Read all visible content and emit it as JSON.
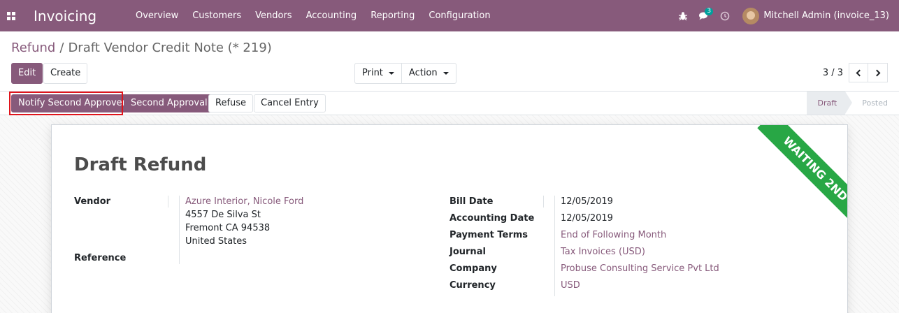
{
  "navbar": {
    "brand": "Invoicing",
    "menu": [
      "Overview",
      "Customers",
      "Vendors",
      "Accounting",
      "Reporting",
      "Configuration"
    ],
    "messages_count": "3",
    "user_name": "Mitchell Admin (invoice_13)",
    "icons": [
      "apps-grid-icon",
      "bug-icon",
      "chat-bubbles-icon",
      "clock-icon"
    ]
  },
  "breadcrumb": {
    "parent": "Refund",
    "separator": "/",
    "current": "Draft Vendor Credit Note (* 219)"
  },
  "toolbar": {
    "edit_label": "Edit",
    "create_label": "Create",
    "print_label": "Print",
    "action_label": "Action",
    "pager_value": "3 / 3"
  },
  "statusbar": {
    "notify_label": "Notify Second Approver",
    "approval_label": "Second Approval",
    "refuse_label": "Refuse",
    "cancel_label": "Cancel Entry",
    "stages": [
      "Draft",
      "Posted"
    ],
    "active_stage": "Draft"
  },
  "sheet": {
    "ribbon": "WAITING 2ND",
    "title": "Draft Refund",
    "vendor_label": "Vendor",
    "vendor_name": "Azure Interior, Nicole Ford",
    "vendor_address": [
      "4557 De Silva St",
      "Fremont CA 94538",
      "United States"
    ],
    "reference_label": "Reference",
    "right_fields": [
      {
        "label": "Bill Date",
        "value": "12/05/2019"
      },
      {
        "label": "Accounting Date",
        "value": "12/05/2019"
      },
      {
        "label": "Payment Terms",
        "value": "End of Following Month"
      },
      {
        "label": "Journal",
        "value": "Tax Invoices (USD)"
      },
      {
        "label": "Company",
        "value": "Probuse Consulting Service Pvt Ltd"
      },
      {
        "label": "Currency",
        "value": "USD"
      }
    ]
  },
  "colors": {
    "brand": "#875a7b",
    "ribbon": "#28a745",
    "highlight": "#e0141c"
  }
}
